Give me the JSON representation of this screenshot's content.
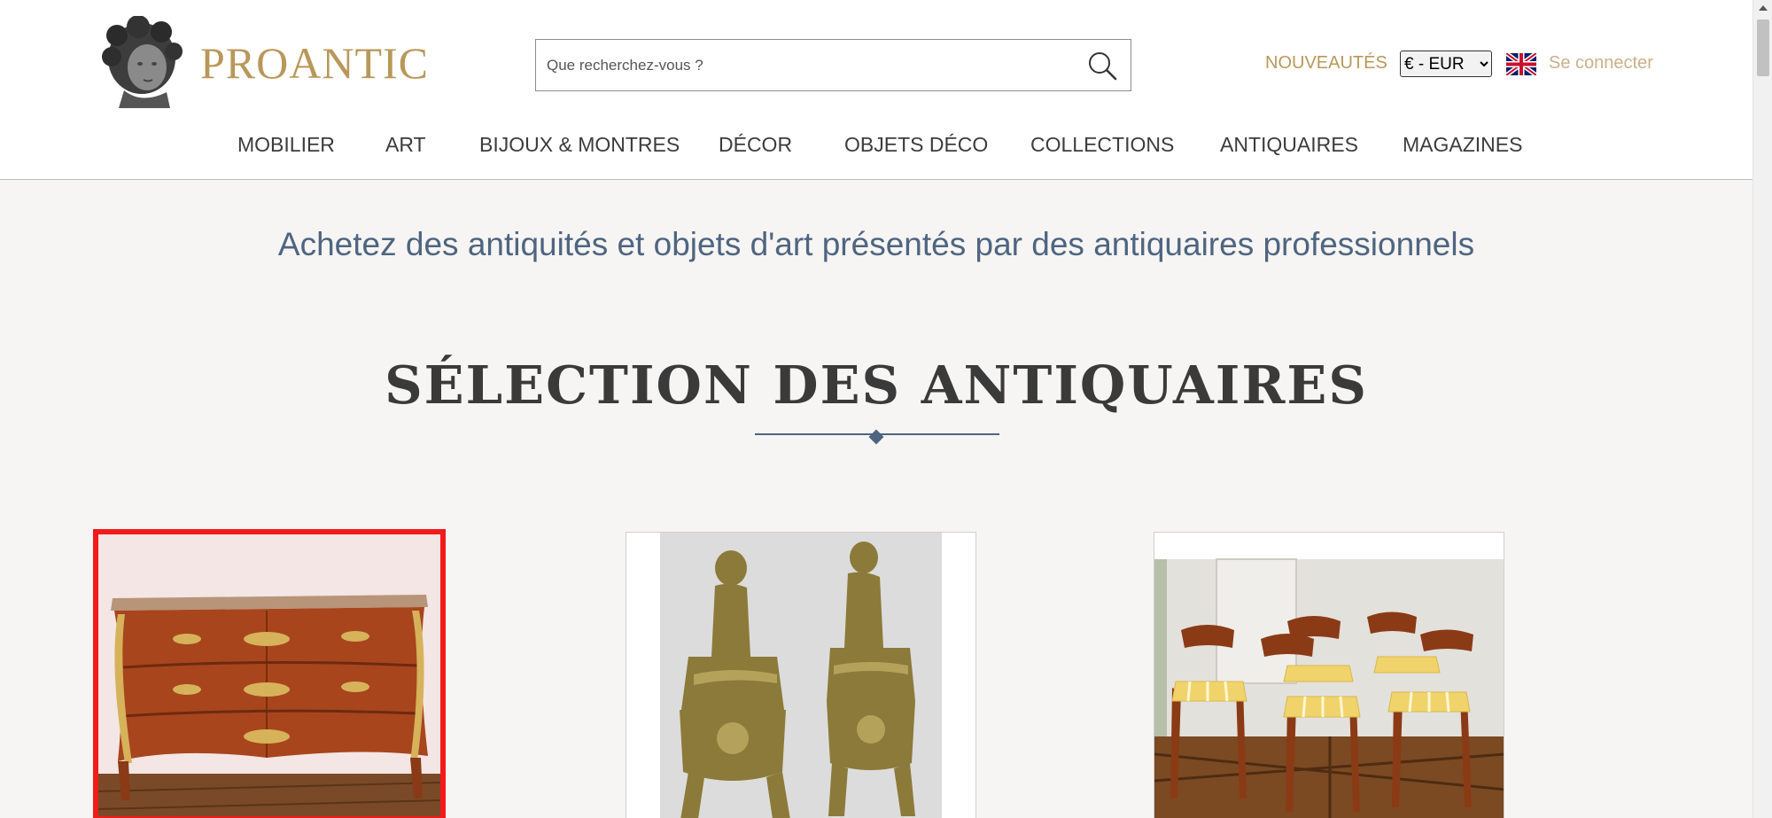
{
  "brand": {
    "name": "PROANTIC",
    "logo_icon": "cherub-bust-logo-icon"
  },
  "header": {
    "search_placeholder": "Que recherchez-vous ?",
    "search_icon": "search-icon",
    "nouveautes": "NOUVEAUTÉS",
    "currency": {
      "selected": "€ - EUR",
      "options": [
        "€ - EUR"
      ]
    },
    "language_flag_icon": "uk-flag-icon",
    "login": "Se connecter"
  },
  "nav": {
    "items": [
      "MOBILIER",
      "ART",
      "BIJOUX & MONTRES",
      "DÉCOR",
      "OBJETS DÉCO",
      "COLLECTIONS",
      "ANTIQUAIRES",
      "MAGAZINES"
    ]
  },
  "tagline": "Achetez des antiquités et objets d'art présentés par des antiquaires professionnels",
  "section": {
    "title": "SÉLECTION DES ANTIQUAIRES"
  },
  "products": [
    {
      "image": "louis-xv-commode-image",
      "selected": true
    },
    {
      "image": "bronze-chenets-putti-image",
      "selected": false
    },
    {
      "image": "mahogany-chairs-set-image",
      "selected": false
    }
  ],
  "colors": {
    "brand_gold": "#b8985a",
    "tagline_blue": "#4e6581",
    "selection_red": "#f21a1a",
    "page_bg": "#f6f5f3"
  }
}
